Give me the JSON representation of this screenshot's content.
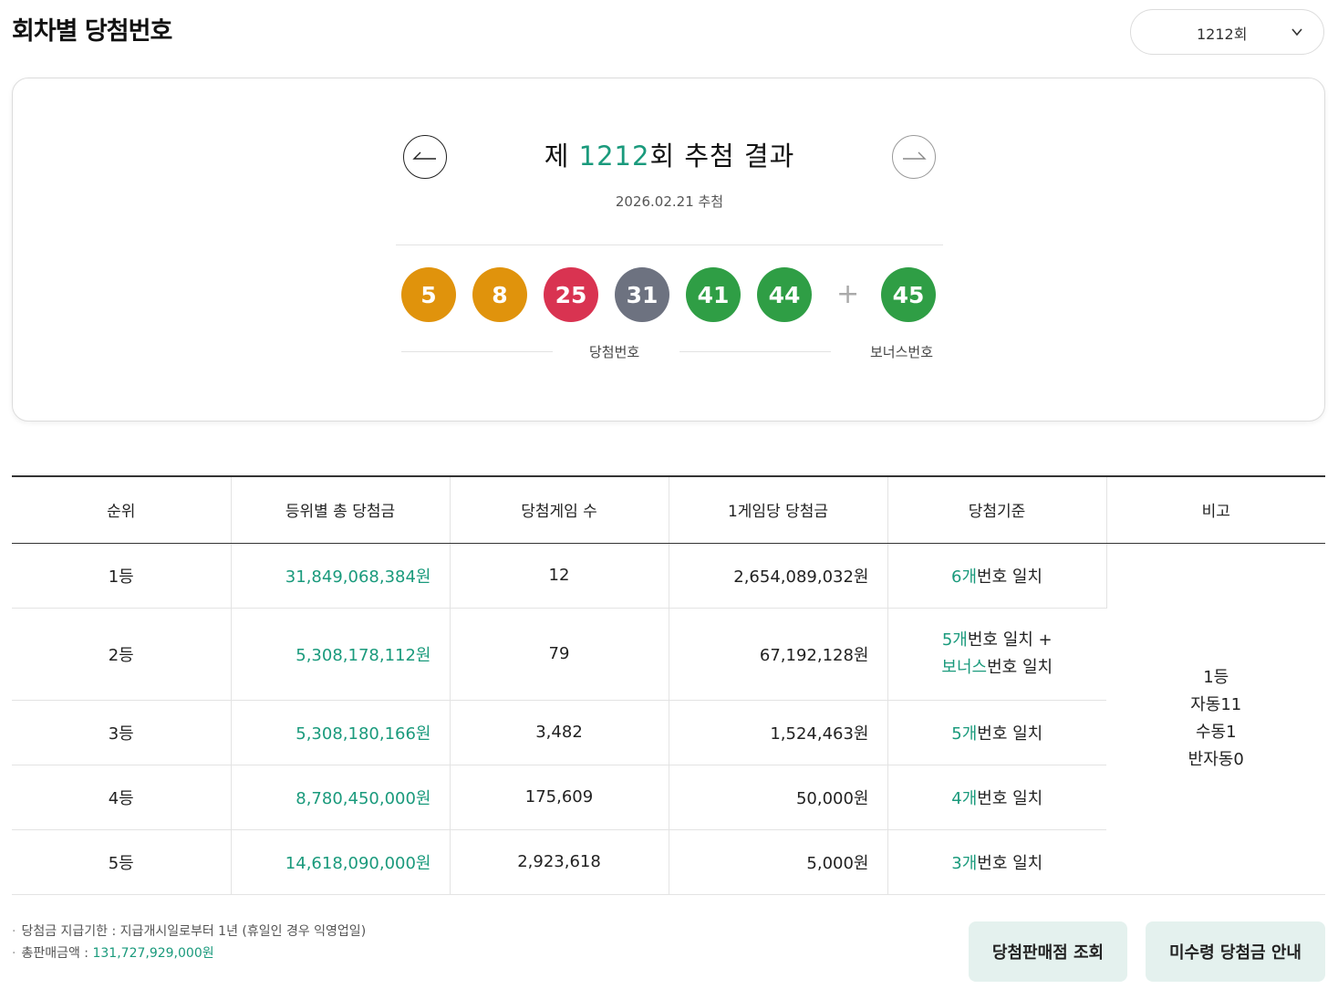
{
  "header": {
    "title": "회차별 당첨번호",
    "round_select_value": "1212회"
  },
  "draw": {
    "title_prefix": "제 ",
    "round_number": "1212",
    "title_suffix": "회 추첨 결과",
    "date": "2026.02.21 추첨",
    "balls": [
      {
        "value": "5",
        "color": "#e0930c"
      },
      {
        "value": "8",
        "color": "#e0930c"
      },
      {
        "value": "25",
        "color": "#d93351"
      },
      {
        "value": "31",
        "color": "#6d7280"
      },
      {
        "value": "41",
        "color": "#2f9e45"
      },
      {
        "value": "44",
        "color": "#2f9e45"
      }
    ],
    "plus": "+",
    "bonus": {
      "value": "45",
      "color": "#2f9e45"
    },
    "winning_label": "당첨번호",
    "bonus_label": "보너스번호"
  },
  "table": {
    "headers": [
      "순위",
      "등위별 총 당첨금",
      "당첨게임 수",
      "1게임당 당첨금",
      "당첨기준",
      "비고"
    ],
    "rows": [
      {
        "rank": "1등",
        "total": "31,849,068,384원",
        "games": "12",
        "per_game": "2,654,089,032원",
        "crit_a": "6개",
        "crit_b": "번호 일치"
      },
      {
        "rank": "2등",
        "total": "5,308,178,112원",
        "games": "79",
        "per_game": "67,192,128원",
        "crit_a": "5개",
        "crit_b": "번호 일치 +",
        "crit_c": "보너스",
        "crit_d": "번호 일치"
      },
      {
        "rank": "3등",
        "total": "5,308,180,166원",
        "games": "3,482",
        "per_game": "1,524,463원",
        "crit_a": "5개",
        "crit_b": "번호 일치"
      },
      {
        "rank": "4등",
        "total": "8,780,450,000원",
        "games": "175,609",
        "per_game": "50,000원",
        "crit_a": "4개",
        "crit_b": "번호 일치"
      },
      {
        "rank": "5등",
        "total": "14,618,090,000원",
        "games": "2,923,618",
        "per_game": "5,000원",
        "crit_a": "3개",
        "crit_b": "번호 일치"
      }
    ],
    "note_lines": [
      "1등",
      "자동11",
      "수동1",
      "반자동0"
    ]
  },
  "footer": {
    "payment_note": "당첨금 지급기한 : 지급개시일로부터 1년 (휴일인 경우 익영업일)",
    "sales_label": "총판매금액 : ",
    "sales_value": "131,727,929,000원",
    "store_button": "당첨판매점 조회",
    "unclaimed_button": "미수령 당첨금 안내"
  },
  "colors": {
    "accent": "#1a9a7c",
    "button_bg": "#e4f1ee"
  },
  "icons": {
    "select": "chevron-down-icon",
    "prev": "arrow-left-icon",
    "next": "arrow-right-icon"
  }
}
